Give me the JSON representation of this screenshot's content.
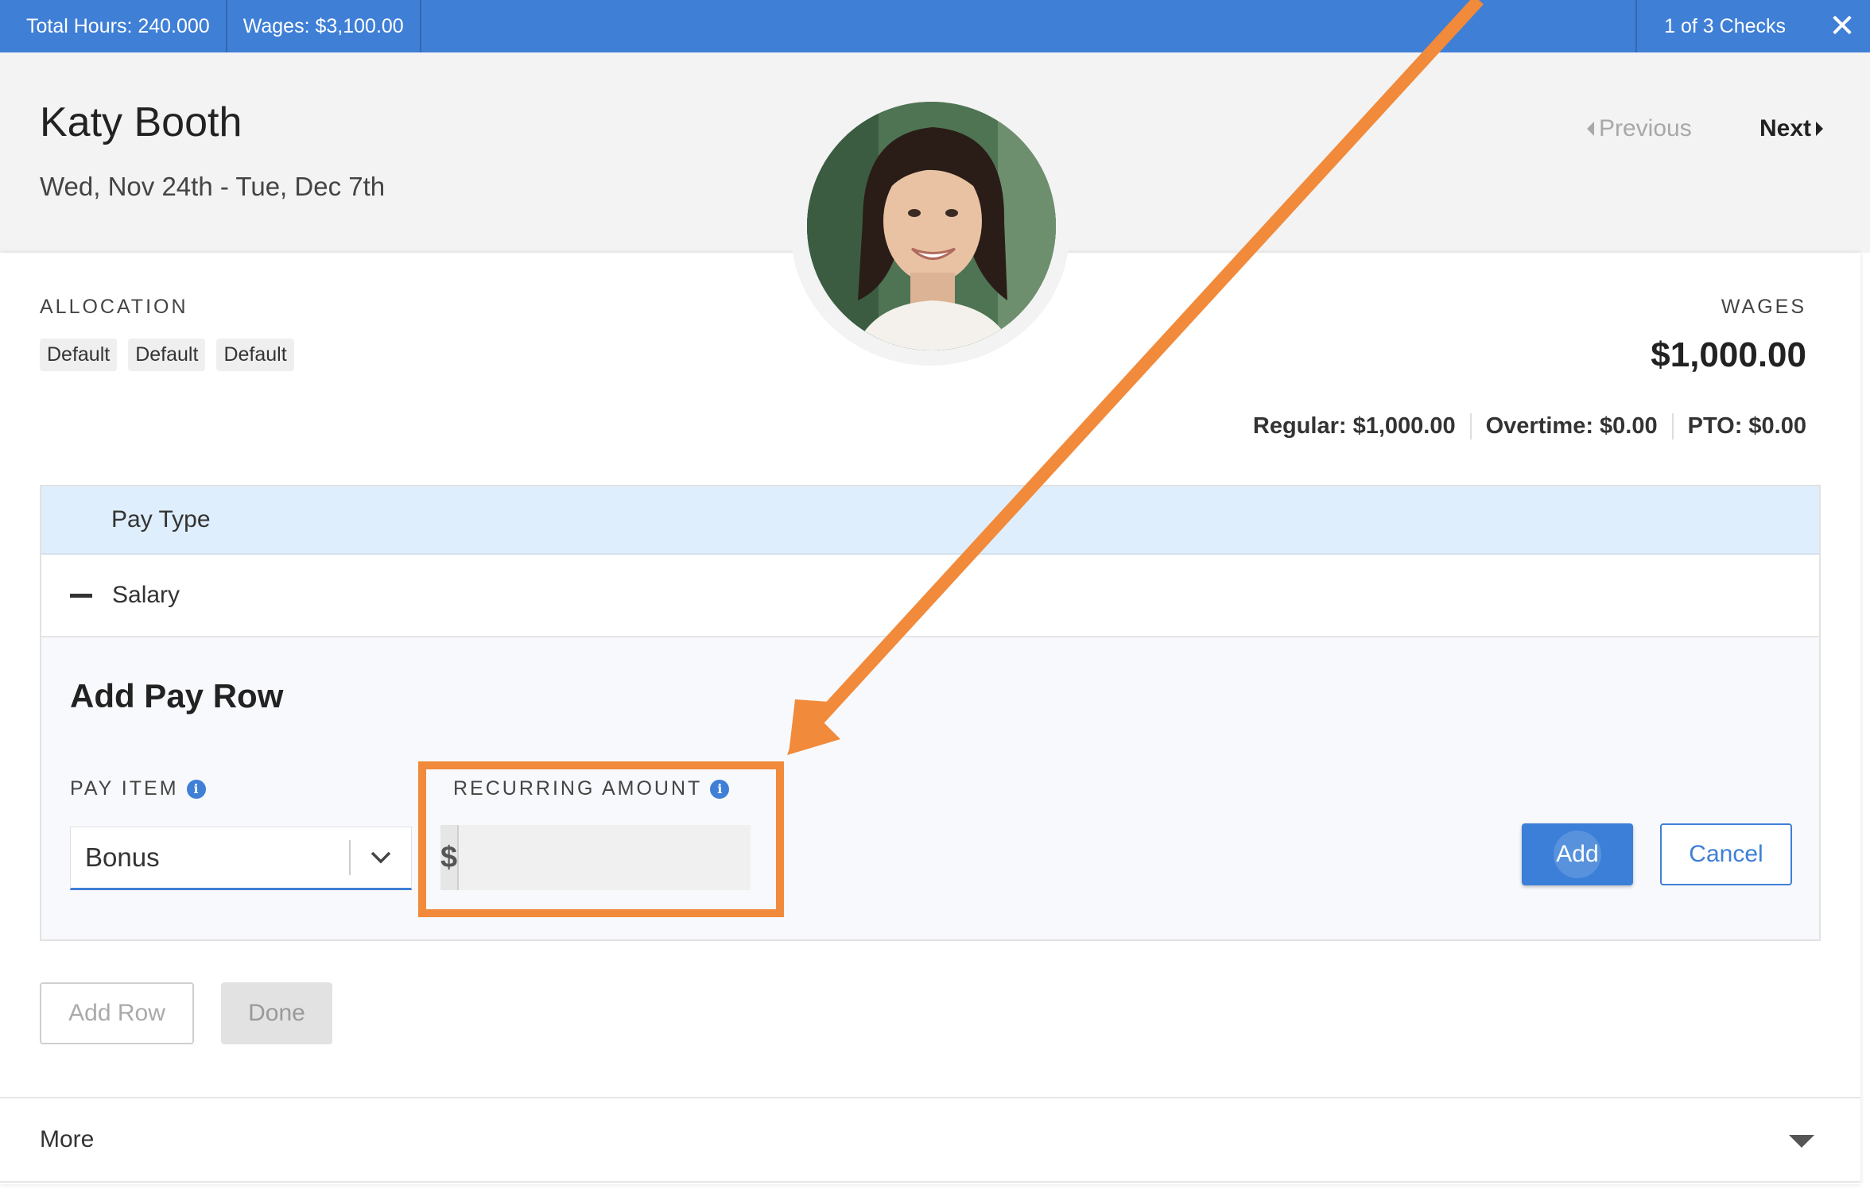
{
  "topbar": {
    "total_hours": "Total Hours: 240.000",
    "wages": "Wages: $3,100.00",
    "checks": "1 of 3 Checks"
  },
  "employee": {
    "name": "Katy Booth",
    "date_range": "Wed, Nov 24th - Tue, Dec 7th"
  },
  "nav": {
    "previous": "Previous",
    "next": "Next"
  },
  "allocation": {
    "label": "ALLOCATION",
    "chips": [
      "Default",
      "Default",
      "Default"
    ]
  },
  "wages": {
    "label": "WAGES",
    "total": "$1,000.00",
    "regular": "Regular: $1,000.00",
    "overtime": "Overtime: $0.00",
    "pto": "PTO: $0.00"
  },
  "table": {
    "header": "Pay Type",
    "row": "Salary"
  },
  "add_pay_row": {
    "title": "Add Pay Row",
    "pay_item_label": "PAY ITEM",
    "pay_item_value": "Bonus",
    "recurring_label": "RECURRING AMOUNT",
    "currency_symbol": "$",
    "amount_value": "",
    "add_label": "Add",
    "cancel_label": "Cancel"
  },
  "actions": {
    "add_row": "Add Row",
    "done": "Done"
  },
  "more": {
    "label": "More"
  },
  "colors": {
    "topbar": "#3f7fd6",
    "highlight": "#f18a3a",
    "accent": "#3b7fd8"
  }
}
